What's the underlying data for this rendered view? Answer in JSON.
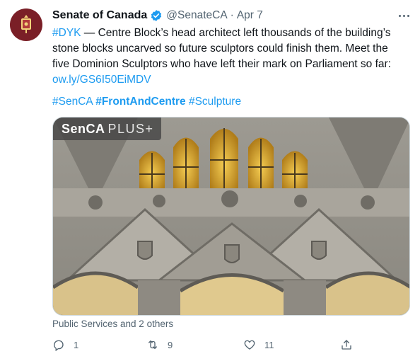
{
  "author": {
    "name": "Senate of Canada",
    "handle": "@SenateCA",
    "date": "Apr 7",
    "verified": true
  },
  "body": {
    "line1_hashtag": "#DYK",
    "line1_text": " — Centre Block’s head architect left thousands of the building’s",
    "line2_text": "stone blocks uncarved so future sculptors could finish them. Meet the",
    "line3_text": "five Dominion Sculptors who have left their mark on Parliament so far:",
    "link": "ow.ly/GS6I50EiMDV"
  },
  "hashtags": {
    "tag1": "#SenCA",
    "tag2": "#FrontAndCentre",
    "tag3": "#Sculpture"
  },
  "media": {
    "watermark_bold": "SenCA",
    "watermark_thin": "PLUS+",
    "description_colors": {
      "stone": "#a8a49b",
      "window_glow": "#e2b23a"
    }
  },
  "tagged_text": "Public Services and 2 others",
  "actions": {
    "reply_count": "1",
    "retweet_count": "9",
    "like_count": "11"
  },
  "colors": {
    "accent": "#1d9bf0",
    "muted": "#536471",
    "avatar_bg": "#7a1f27"
  }
}
